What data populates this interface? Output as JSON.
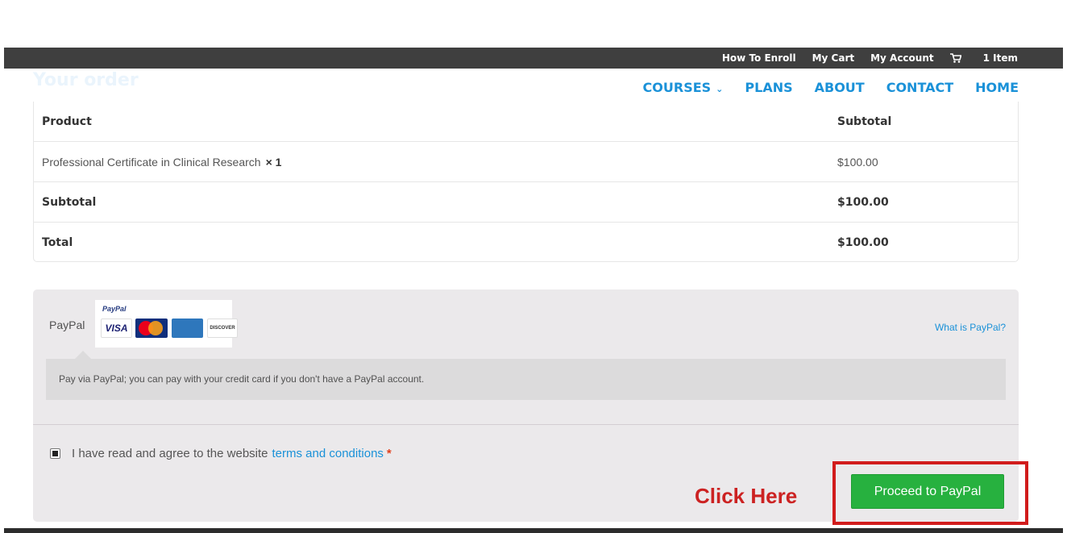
{
  "topbar": {
    "links": [
      "How To Enroll",
      "My Cart",
      "My Account"
    ],
    "cart_count": "1 Item",
    "cart_icon": "shopping-cart-icon"
  },
  "heading": "Your order",
  "nav": {
    "courses": "COURSES",
    "plans": "PLANS",
    "about": "ABOUT",
    "contact": "CONTACT",
    "home": "HOME"
  },
  "order": {
    "col_product": "Product",
    "col_subtotal": "Subtotal",
    "item_name": "Professional Certificate in Clinical Research",
    "item_qty": "× 1",
    "item_price": "$100.00",
    "subtotal_label": "Subtotal",
    "subtotal_value": "$100.00",
    "total_label": "Total",
    "total_value": "$100.00"
  },
  "payment": {
    "method_label": "PayPal",
    "logo_brand": "PayPal",
    "cards": [
      "VISA",
      "MasterCard",
      "AMEX",
      "DISCOVER"
    ],
    "what_link": "What is PayPal?",
    "description": "Pay via PayPal; you can pay with your credit card if you don't have a PayPal account."
  },
  "terms": {
    "text": "I have read and agree to the website",
    "link": "terms and conditions",
    "required": "*",
    "checked": true
  },
  "annotation": {
    "click_here": "Click Here"
  },
  "proceed_button": "Proceed to PayPal",
  "colors": {
    "accent": "#1a91d8",
    "button": "#27b13f",
    "annotation": "#cc2222"
  }
}
